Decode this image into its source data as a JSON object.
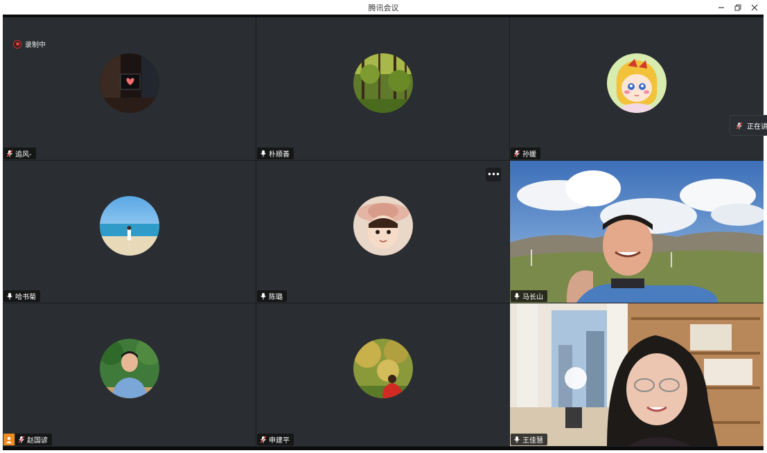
{
  "window": {
    "title": "腾讯会议"
  },
  "recording": {
    "label": "录制中"
  },
  "side_popup": {
    "text": "正在讲"
  },
  "participants": [
    {
      "name": "追风-",
      "mic": "muted"
    },
    {
      "name": "朴顺善",
      "mic": "on"
    },
    {
      "name": "孙媛",
      "mic": "muted"
    },
    {
      "name": "哈书菊",
      "mic": "on"
    },
    {
      "name": "陈璐",
      "mic": "on"
    },
    {
      "name": "马长山",
      "mic": "on",
      "speaking": true
    },
    {
      "name": "赵国谚",
      "mic": "muted"
    },
    {
      "name": "申建平",
      "mic": "muted"
    },
    {
      "name": "王佳慧",
      "mic": "on"
    }
  ],
  "colors": {
    "speaking_border": "#27c27a",
    "tile_bg": "#2a2d31",
    "badge_orange": "#f08c1e"
  }
}
